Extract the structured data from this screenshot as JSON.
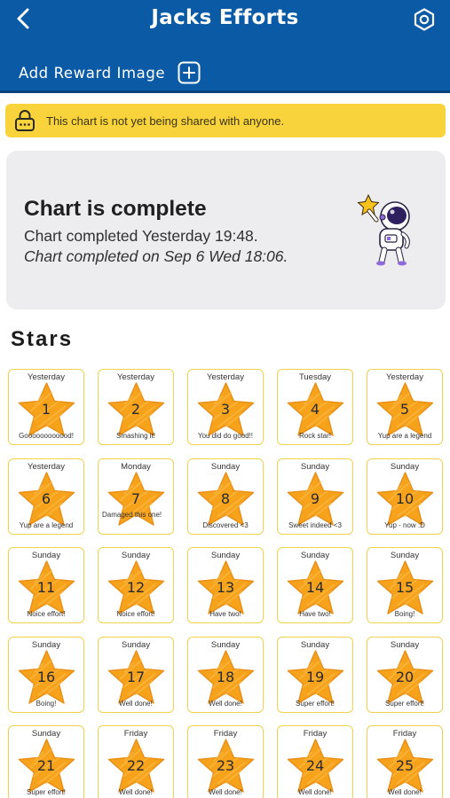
{
  "header": {
    "title": "Jacks Efforts",
    "back_icon": "chevron-left-icon",
    "settings_icon": "gear-icon",
    "reward_label": "Add Reward Image",
    "reward_icon": "plus-square-icon"
  },
  "banner": {
    "text": "This chart is not yet being shared with anyone.",
    "icon": "lock-icon"
  },
  "completion": {
    "title": "Chart is complete",
    "line1": "Chart completed Yesterday 19:48.",
    "line2": "Chart completed on Sep 6 Wed 18:06.",
    "image": "astronaut-with-star"
  },
  "stars_heading": "Stars",
  "stars": [
    {
      "day": "Yesterday",
      "number": "1",
      "message": "Goooooooooood!"
    },
    {
      "day": "Yesterday",
      "number": "2",
      "message": "Smashing it!"
    },
    {
      "day": "Yesterday",
      "number": "3",
      "message": "You did do good!!"
    },
    {
      "day": "Tuesday",
      "number": "4",
      "message": "Rock star!"
    },
    {
      "day": "Yesterday",
      "number": "5",
      "message": "Yup are a legend"
    },
    {
      "day": "Yesterday",
      "number": "6",
      "message": "Yup are a legend"
    },
    {
      "day": "Monday",
      "number": "7",
      "message": "Damaged this one!"
    },
    {
      "day": "Sunday",
      "number": "8",
      "message": "Discovered <3"
    },
    {
      "day": "Sunday",
      "number": "9",
      "message": "Sweet indeed <3"
    },
    {
      "day": "Sunday",
      "number": "10",
      "message": "Yup - now :D"
    },
    {
      "day": "Sunday",
      "number": "11",
      "message": "Noice effort!"
    },
    {
      "day": "Sunday",
      "number": "12",
      "message": "Noice effort!"
    },
    {
      "day": "Sunday",
      "number": "13",
      "message": "Have two!"
    },
    {
      "day": "Sunday",
      "number": "14",
      "message": "Have two!"
    },
    {
      "day": "Sunday",
      "number": "15",
      "message": "Boing!"
    },
    {
      "day": "Sunday",
      "number": "16",
      "message": "Boing!"
    },
    {
      "day": "Sunday",
      "number": "17",
      "message": "Well done!"
    },
    {
      "day": "Sunday",
      "number": "18",
      "message": "Well done!"
    },
    {
      "day": "Sunday",
      "number": "19",
      "message": "Super effort!"
    },
    {
      "day": "Sunday",
      "number": "20",
      "message": "Super effort!"
    },
    {
      "day": "Sunday",
      "number": "21",
      "message": "Super effort!"
    },
    {
      "day": "Friday",
      "number": "22",
      "message": "Well done!"
    },
    {
      "day": "Friday",
      "number": "23",
      "message": "Well done!"
    },
    {
      "day": "Friday",
      "number": "24",
      "message": "Well done!"
    },
    {
      "day": "Friday",
      "number": "25",
      "message": "Well done!"
    }
  ],
  "colors": {
    "header": "#0b5aa6",
    "banner": "#f8d33b",
    "card": "#ededf0",
    "star": "#f7a21b",
    "tile_border": "#f0d24f"
  }
}
